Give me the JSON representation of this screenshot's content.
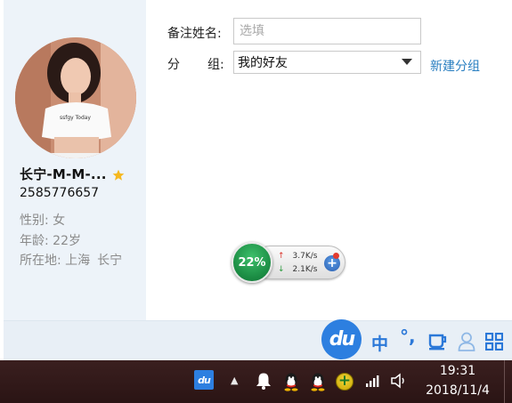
{
  "profile": {
    "nickname": "长宁-M-M-...",
    "qq_number": "2585776657",
    "gender_label": "性别:",
    "gender": "女",
    "age_label": "年龄:",
    "age": "22岁",
    "location_label": "所在地:",
    "location_province": "上海",
    "location_city": "长宁",
    "star_icon": "star-icon",
    "star_color": "#f5b820"
  },
  "form": {
    "remark_label": "备注姓名:",
    "remark_placeholder": "选填",
    "remark_value": "",
    "group_label_1": "分",
    "group_label_2": "组:",
    "group_selected": "我的好友",
    "new_group_link": "新建分组",
    "link_color": "#2a7fc1"
  },
  "speed_widget": {
    "percent": "22%",
    "upload": "3.7K/s",
    "download": "2.1K/s",
    "plus": "+"
  },
  "ime_bar": {
    "logo": "du",
    "mode": "中",
    "punct": "°,",
    "accent_color": "#2b78d8"
  },
  "taskbar": {
    "app_icon": "du",
    "chevron": "▲",
    "plus": "+",
    "time": "19:31",
    "date": "2018/11/4"
  }
}
